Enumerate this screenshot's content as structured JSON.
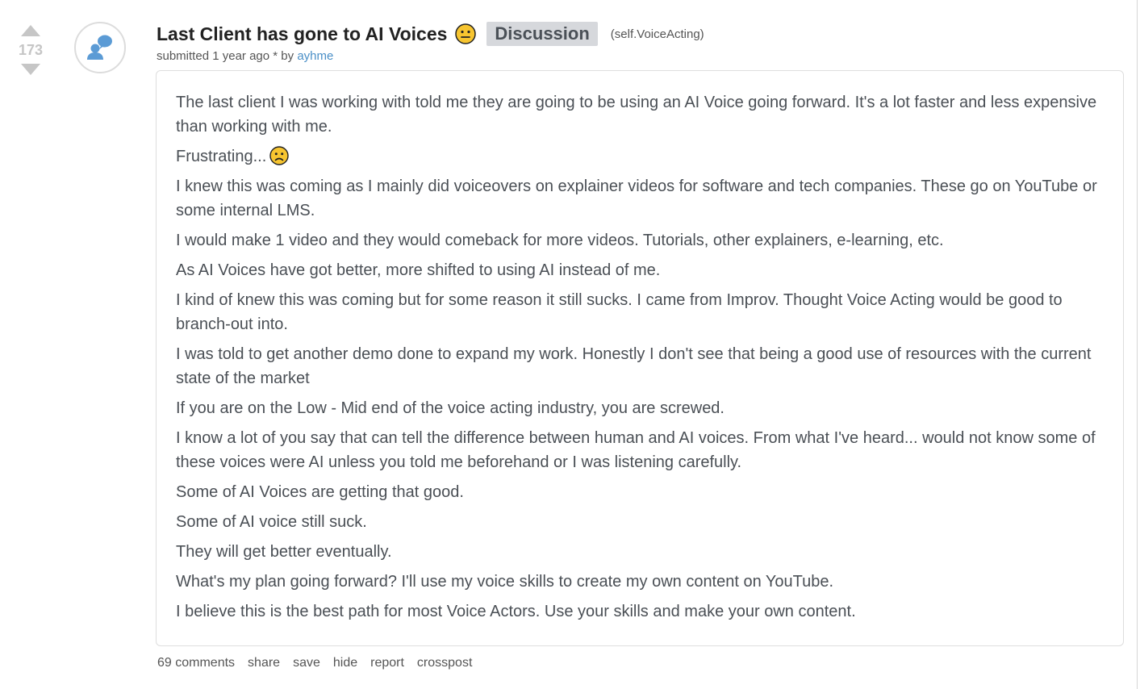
{
  "vote": {
    "score": "173"
  },
  "post": {
    "title": "Last Client has gone to AI Voices",
    "flair": "Discussion",
    "domain": "(self.VoiceActing)",
    "tagline": {
      "submitted": "submitted",
      "time": "1 year ago",
      "edited_mark": "*",
      "by": "by",
      "author": "ayhme"
    },
    "thumbnail_icon": "self-post-speech-bubble-icon",
    "title_emoji": "neutral-face-emoji",
    "body_emoji": "sad-face-emoji",
    "paragraphs": [
      "The last client I was working with told me they are going to be using an AI Voice going forward. It's a lot faster and less expensive than working with me.",
      "Frustrating...",
      "I knew this was coming as I mainly did voiceovers on explainer videos for software and tech companies. These go on YouTube or some internal LMS.",
      "I would make 1 video and they would comeback for more videos. Tutorials, other explainers, e-learning, etc.",
      "As AI Voices have got better, more shifted to using AI instead of me.",
      "I kind of knew this was coming but for some reason it still sucks. I came from Improv. Thought Voice Acting would be good to branch-out into.",
      "I was told to get another demo done to expand my work. Honestly I don't see that being a good use of resources with the current state of the market",
      "If you are on the Low - Mid end of the voice acting industry, you are screwed.",
      "I know a lot of you say that can tell the difference between human and AI voices. From what I've heard... would not know some of these voices were AI unless you told me beforehand or I was listening carefully.",
      "Some of AI Voices are getting that good.",
      "Some of AI voice still suck.",
      "They will get better eventually.",
      "What's my plan going forward? I'll use my voice skills to create my own content on YouTube.",
      "I believe this is the best path for most Voice Actors. Use your skills and make your own content."
    ]
  },
  "buttons": {
    "comments": "69 comments",
    "share": "share",
    "save": "save",
    "hide": "hide",
    "report": "report",
    "crosspost": "crosspost"
  },
  "colors": {
    "vote_arrow": "#c6c6c6",
    "author_link": "#4a8fc7",
    "flair_bg": "#d6d8dc",
    "body_text": "#4a4f55",
    "thumbnail_icon": "#5b9bd5"
  }
}
